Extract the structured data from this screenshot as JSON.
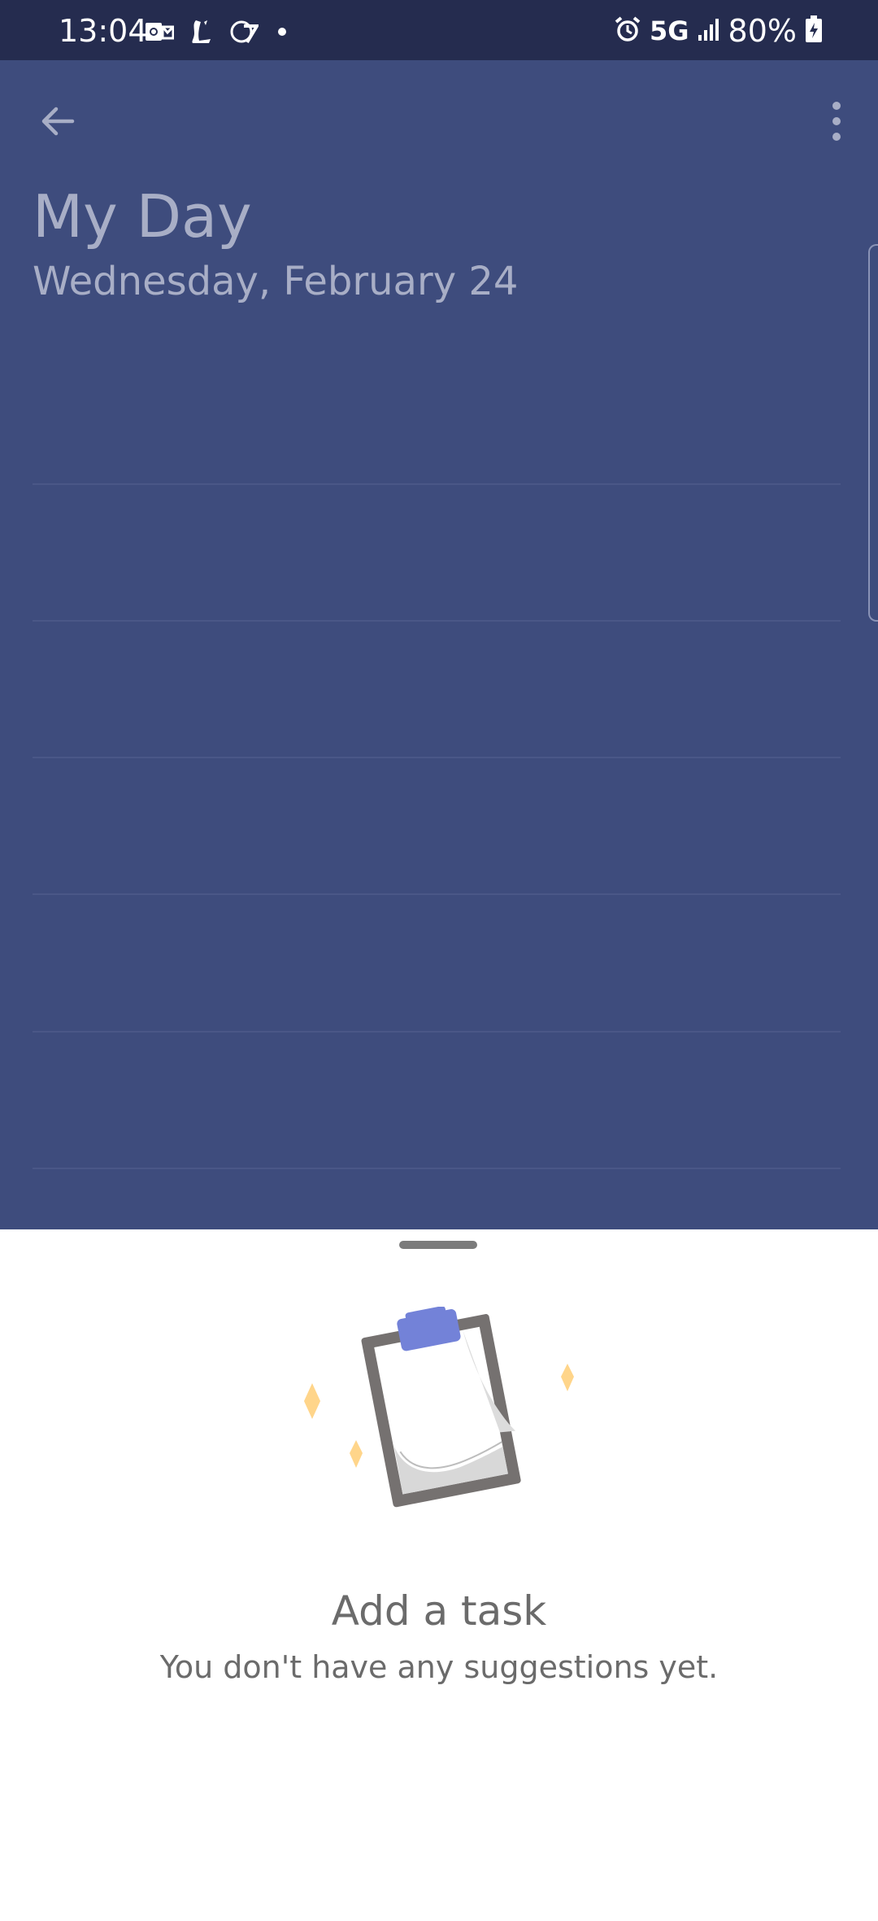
{
  "status_bar": {
    "time": "13:04",
    "network": "5G",
    "battery": "80%",
    "left_icons": [
      "outlook-icon",
      "latimes-icon",
      "abc7-icon"
    ],
    "right_icons": [
      "alarm-icon",
      "signal-icon",
      "battery-charging-icon"
    ]
  },
  "header": {
    "back_icon": "arrow-left-icon",
    "more_icon": "more-vertical-icon",
    "title": "My Day",
    "subtitle": "Wednesday, February 24"
  },
  "suggestions_sheet": {
    "illustration": "clipboard-icon",
    "title": "Add a task",
    "subtitle": "You don't have any suggestions yet."
  },
  "colors": {
    "status_bar": "#252c4f",
    "background": "#3e4c7d",
    "title_text": "#a8aec6",
    "sheet": "#ffffff",
    "accent": "#7382d8",
    "sparkle": "#ffd58a"
  }
}
